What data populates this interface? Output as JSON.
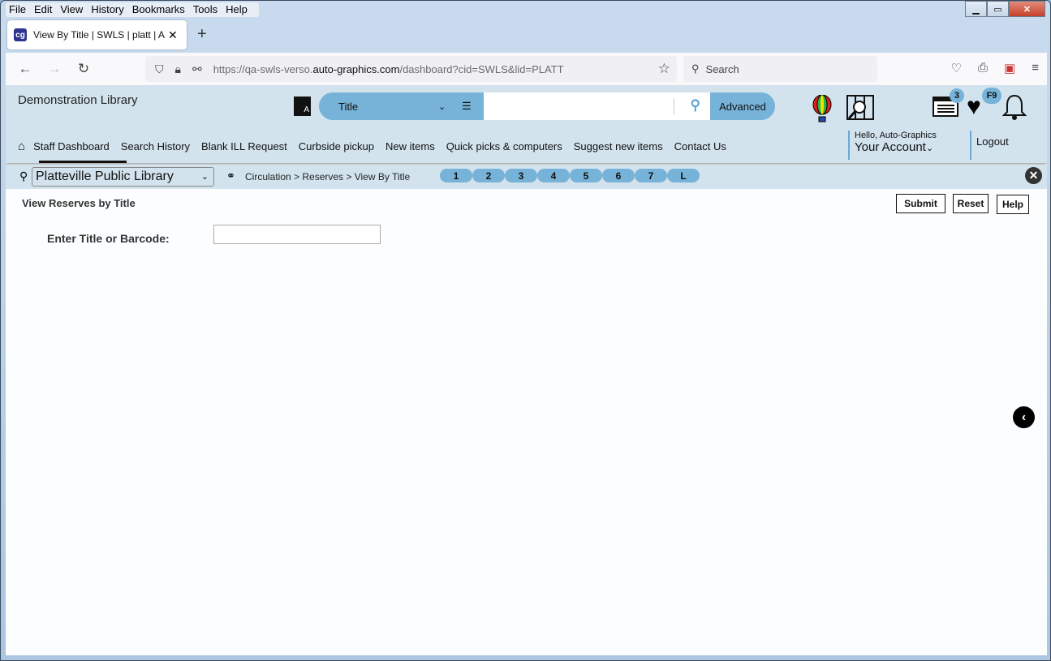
{
  "browser": {
    "menu": [
      "File",
      "Edit",
      "View",
      "History",
      "Bookmarks",
      "Tools",
      "Help"
    ],
    "tab_title": "View By Title | SWLS | platt | Auto-Graphics",
    "url_host_prefix": "https://qa-swls-verso.",
    "url_host": "auto-graphics.com",
    "url_path": "/dashboard?cid=SWLS&lid=PLATT",
    "search_placeholder": "Search"
  },
  "header": {
    "library_name": "Demonstration Library",
    "search_type": "Title",
    "search_value": "",
    "advanced_label": "Advanced",
    "list_badge": "3",
    "heart_badge": "F9",
    "greeting": "Hello, Auto-Graphics",
    "account_label": "Your Account",
    "logout_label": "Logout"
  },
  "nav": {
    "items": [
      "Staff Dashboard",
      "Search History",
      "Blank ILL Request",
      "Curbside pickup",
      "New items",
      "Quick picks & computers",
      "Suggest new items",
      "Contact Us"
    ]
  },
  "subbar": {
    "library_select": "Platteville Public Library",
    "breadcrumb": "Circulation > Reserves > View By Title",
    "pills": [
      "1",
      "2",
      "3",
      "4",
      "5",
      "6",
      "7",
      "L"
    ]
  },
  "content": {
    "title": "View Reserves by Title",
    "submit_label": "Submit",
    "reset_label": "Reset",
    "help_label": "Help",
    "field_label": "Enter Title or Barcode:",
    "field_value": ""
  }
}
